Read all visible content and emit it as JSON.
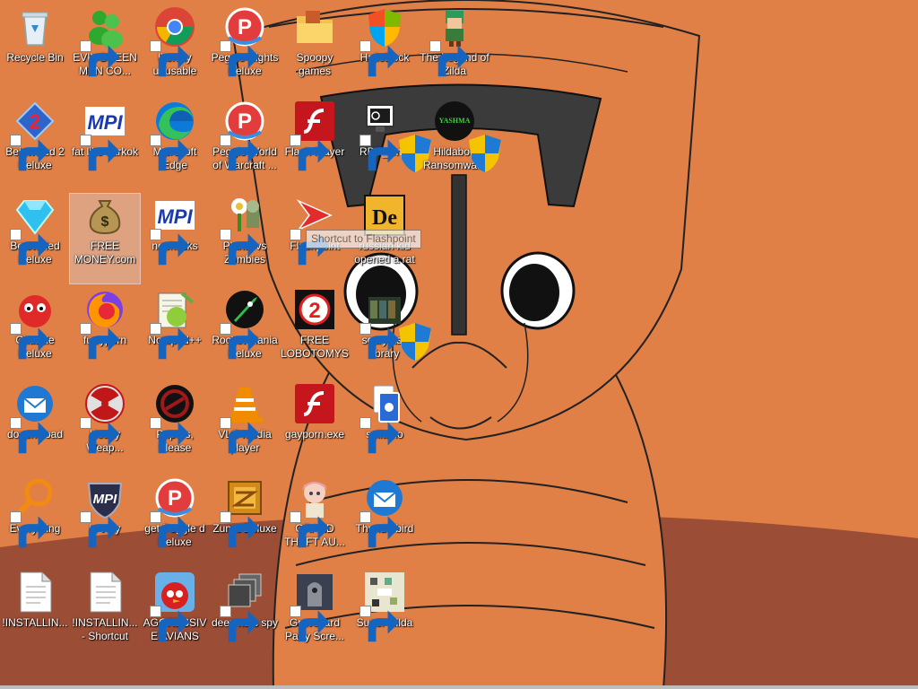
{
  "desktop": {
    "icons": [
      {
        "label": "Recycle Bin",
        "icon": "recycle-bin-icon"
      },
      {
        "label": "EVIL GREEN MEN CO...",
        "icon": "green-men-icon"
      },
      {
        "label": "literally unusable",
        "icon": "chrome-icon"
      },
      {
        "label": "Peggle Nights Deluxe",
        "icon": "peggle-icon"
      },
      {
        "label": "Spoopy games",
        "icon": "folder-icon"
      },
      {
        "label": "HalloDock",
        "icon": "shield-icon"
      },
      {
        "label": "The Legend of Zilda",
        "icon": "zilda-icon"
      },
      {
        "label": "Bejeweled 2 Deluxe",
        "icon": "bejeweled2-icon"
      },
      {
        "label": "fat like darkok",
        "icon": "mpi-icon"
      },
      {
        "label": "Microsoft Edge",
        "icon": "edge-icon"
      },
      {
        "label": "Peggle World of Warcraft ...",
        "icon": "peggle-icon"
      },
      {
        "label": "Flash Player",
        "icon": "flash-icon"
      },
      {
        "label": "RDP_CnC",
        "icon": "rdp-icon"
      },
      {
        "label": "Hildaboo Ransomwa...",
        "icon": "yashma-icon"
      },
      {
        "label": "Bejeweled Deluxe",
        "icon": "gem-icon"
      },
      {
        "label": "FREE MONEY.com",
        "icon": "money-bag-icon"
      },
      {
        "label": "nephacks",
        "icon": "mpi-icon"
      },
      {
        "label": "Plants vs Zombies",
        "icon": "plants-icon"
      },
      {
        "label": "Flashpoint",
        "icon": "flashpoint-icon"
      },
      {
        "label": "russian kid opened a rat",
        "icon": "de-icon"
      },
      {
        "label": "Chuzzle Deluxe",
        "icon": "chuzzle-icon"
      },
      {
        "label": "furryporn",
        "icon": "firefox-icon"
      },
      {
        "label": "Notepad++",
        "icon": "notepad-icon"
      },
      {
        "label": "Rocket Mania Deluxe",
        "icon": "rocket-icon"
      },
      {
        "label": "FREE LOBOTOMYS",
        "icon": "lobotomy-icon"
      },
      {
        "label": "scary ass library",
        "icon": "library-icon"
      },
      {
        "label": "doesnt load",
        "icon": "thunderbird-icon"
      },
      {
        "label": "Heavy Weap...",
        "icon": "radiation-icon"
      },
      {
        "label": "Papers, Please",
        "icon": "papers-please-icon"
      },
      {
        "label": "VLC media player",
        "icon": "vlc-icon"
      },
      {
        "label": "gayporn.exe",
        "icon": "flash-icon"
      },
      {
        "label": "solitario",
        "icon": "solitaire-icon"
      },
      {
        "label": "Everything",
        "icon": "search-icon"
      },
      {
        "label": "is very",
        "icon": "mpi-shield-icon"
      },
      {
        "label": "get Peggle d Deluxe",
        "icon": "peggle-icon"
      },
      {
        "label": "Zuma Deluxe",
        "icon": "zuma-icon"
      },
      {
        "label": "GRAND THEFT AU...",
        "icon": "anime-girl-icon"
      },
      {
        "label": "Thunderbird",
        "icon": "thunderbird-icon"
      },
      {
        "label": "!INSTALLIN...",
        "icon": "document-icon"
      },
      {
        "label": "!INSTALLIN... - Shortcut",
        "icon": "document-icon"
      },
      {
        "label": "AGGRESSIVE AVIANS",
        "icon": "angry-bird-icon"
      },
      {
        "label": "deez nuts spy",
        "icon": "stack-icon"
      },
      {
        "label": "Graveyard Party Scre...",
        "icon": "graveyard-icon"
      },
      {
        "label": "Super Hilda",
        "icon": "pixel-icon"
      }
    ],
    "tooltip": "Shortcut to Flashpoint"
  },
  "colors": {
    "wallpaper_orange": "#e07f46",
    "wallpaper_dark": "#9b4d35",
    "visor": "#3b3b3b"
  }
}
